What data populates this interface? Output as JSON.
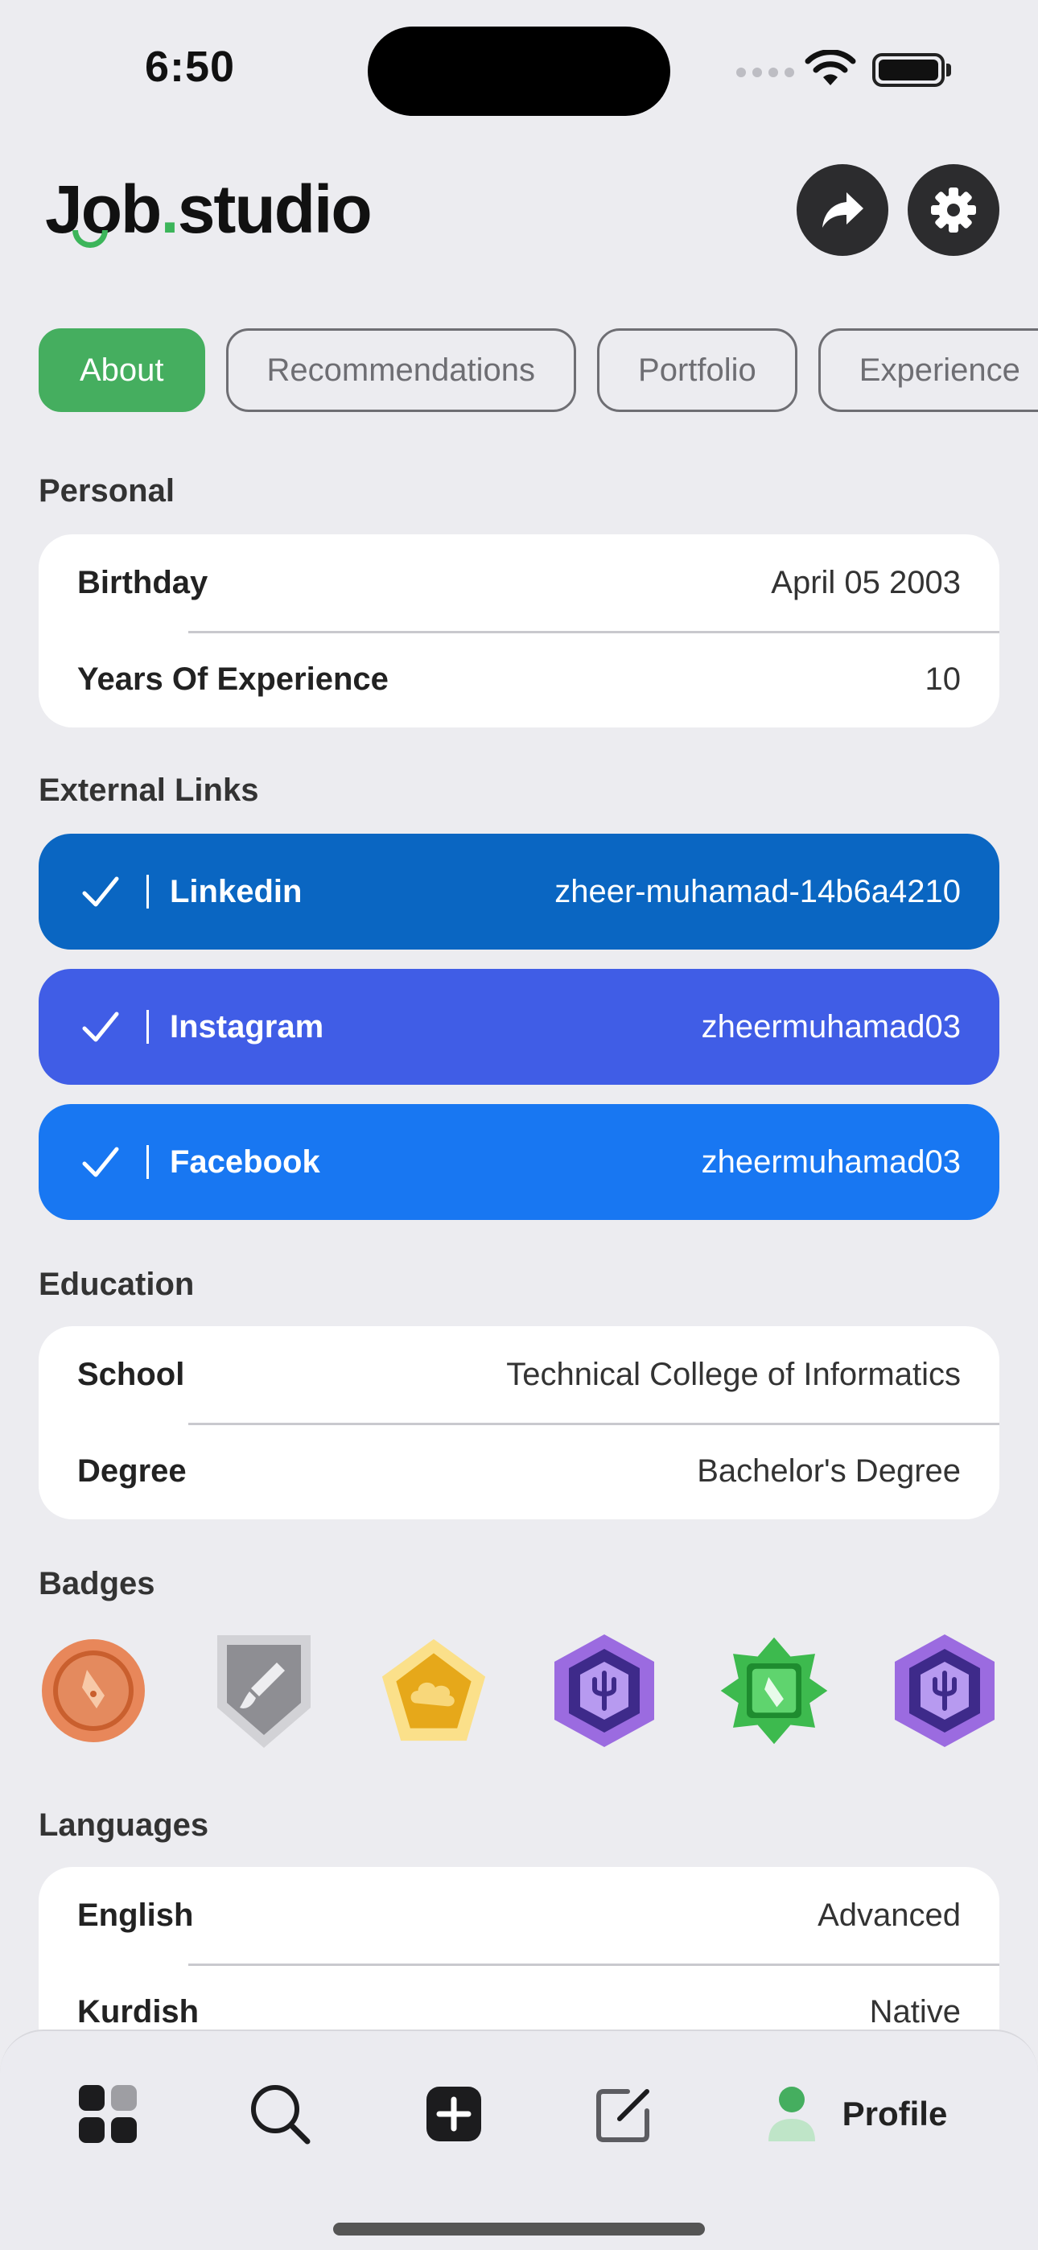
{
  "status_bar": {
    "time": "6:50"
  },
  "header": {
    "logo_prefix": "Job",
    "logo_dot": ".",
    "logo_suffix": "studio"
  },
  "tabs": [
    {
      "label": "About",
      "active": true
    },
    {
      "label": "Recommendations",
      "active": false
    },
    {
      "label": "Portfolio",
      "active": false
    },
    {
      "label": "Experience",
      "active": false
    }
  ],
  "personal": {
    "title": "Personal",
    "rows": [
      {
        "label": "Birthday",
        "value": "April 05 2003"
      },
      {
        "label": "Years Of Experience",
        "value": "10"
      }
    ]
  },
  "external_links": {
    "title": "External Links",
    "items": [
      {
        "name": "Linkedin",
        "handle": "zheer-muhamad-14b6a4210",
        "color": "#0A66C2"
      },
      {
        "name": "Instagram",
        "handle": "zheermuhamad03",
        "color": "#405DE6"
      },
      {
        "name": "Facebook",
        "handle": "zheermuhamad03",
        "color": "#1877F2"
      }
    ]
  },
  "education": {
    "title": "Education",
    "rows": [
      {
        "label": "School",
        "value": "Technical College of Informatics"
      },
      {
        "label": "Degree",
        "value": "Bachelor's Degree"
      }
    ]
  },
  "badges": {
    "title": "Badges",
    "items": [
      {
        "icon": "pen-nib-bronze-circle-badge",
        "color": "#D9733F"
      },
      {
        "icon": "brush-silver-shield-badge",
        "color": "#9A9A9E"
      },
      {
        "icon": "cloud-gold-pentagon-badge",
        "color": "#F2C23A"
      },
      {
        "icon": "trident-purple-hexagon-badge",
        "color": "#8B5CD6"
      },
      {
        "icon": "pen-nib-green-star-badge",
        "color": "#3DBA4E"
      },
      {
        "icon": "trident-purple-hexagon-badge",
        "color": "#8B5CD6"
      }
    ]
  },
  "languages": {
    "title": "Languages",
    "rows": [
      {
        "label": "English",
        "value": "Advanced"
      },
      {
        "label": "Kurdish",
        "value": "Native"
      }
    ]
  },
  "bottom_nav": {
    "items": [
      {
        "icon": "dashboard-grid-icon"
      },
      {
        "icon": "search-icon"
      },
      {
        "icon": "add-icon"
      },
      {
        "icon": "edit-icon"
      },
      {
        "icon": "profile-icon",
        "label": "Profile",
        "active": true
      }
    ]
  },
  "colors": {
    "accent": "#45AE5F",
    "background": "#ECECF0",
    "button_dark": "#2C2C2E"
  }
}
